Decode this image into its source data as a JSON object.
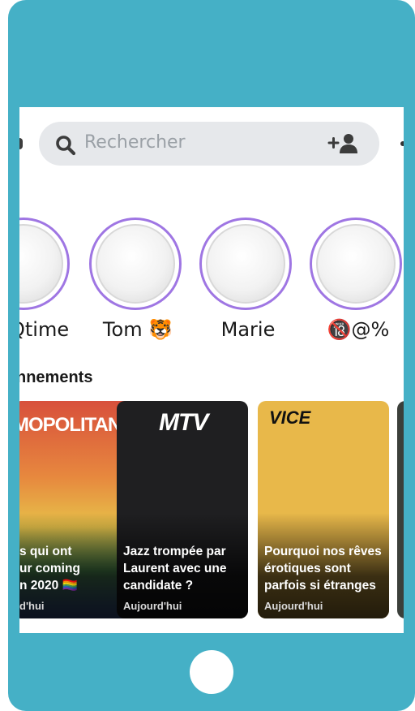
{
  "search": {
    "placeholder": "Rechercher"
  },
  "stories": [
    {
      "name": "Qtime"
    },
    {
      "name": "Tom 🐯"
    },
    {
      "name": "Marie"
    },
    {
      "name": "🔞@%"
    }
  ],
  "section": {
    "title": "nnements"
  },
  "cards": [
    {
      "brand": "MOPOLITAN",
      "title": "s qui ont\nur coming\nn 2020 🏳️‍🌈",
      "time": "d'hui"
    },
    {
      "brand": "MTV",
      "title": "Jazz trompée par Laurent avec une candidate ?",
      "time": "Aujourd'hui"
    },
    {
      "brand": "VICE",
      "title": "Pourquoi nos rêves érotiques sont parfois si étranges",
      "time": "Aujourd'hui"
    }
  ],
  "colors": {
    "frame": "#45b0c6",
    "story_ring": "#9f76e3"
  }
}
